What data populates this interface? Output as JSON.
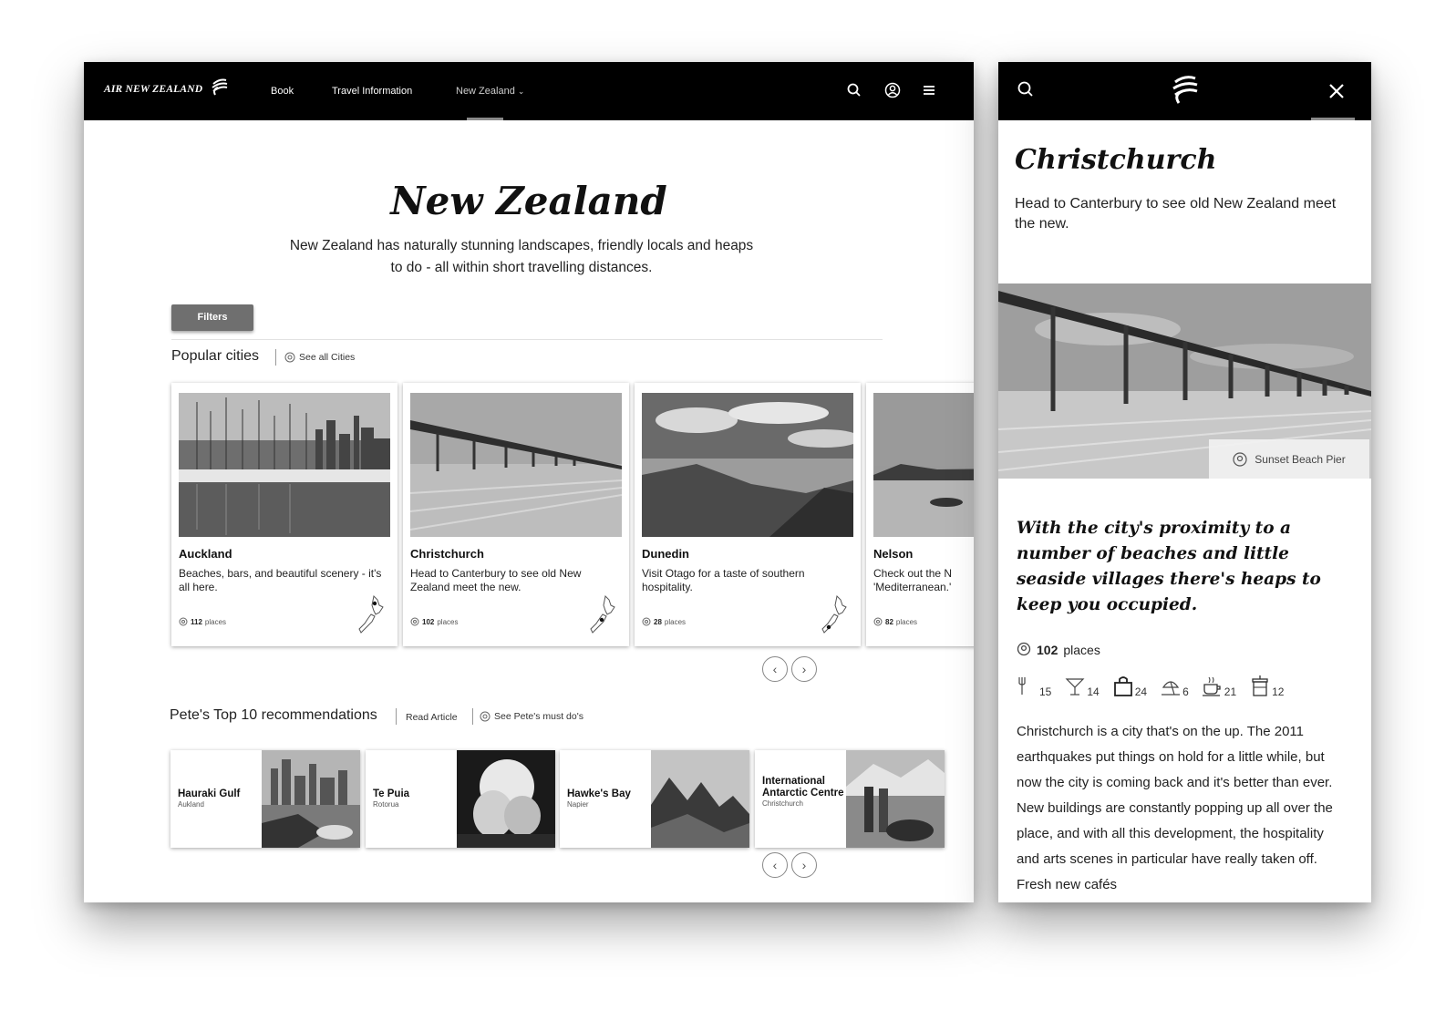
{
  "desktop": {
    "nav": {
      "brand": "AIR NEW ZEALAND",
      "links": {
        "book": "Book",
        "travel": "Travel Information",
        "nz": "New Zealand"
      }
    },
    "hero": {
      "title": "New Zealand",
      "subtitle": "New Zealand has naturally stunning landscapes, friendly locals and heaps to do - all within short travelling distances."
    },
    "filters_label": "Filters",
    "popular": {
      "title": "Popular cities",
      "see_all": "See all Cities",
      "cities": [
        {
          "name": "Auckland",
          "desc": "Beaches, bars, and beautiful scenery - it's all here.",
          "count": "112",
          "unit": "places"
        },
        {
          "name": "Christchurch",
          "desc": "Head to Canterbury to see old New Zealand meet the new.",
          "count": "102",
          "unit": "places"
        },
        {
          "name": "Dunedin",
          "desc": "Visit Otago for a taste of southern hospitality.",
          "count": "28",
          "unit": "places"
        },
        {
          "name": "Nelson",
          "desc": "Check out the N 'Mediterranean.'",
          "count": "82",
          "unit": "places"
        }
      ]
    },
    "recs": {
      "title": "Pete's Top 10 recommendations",
      "read_article": "Read Article",
      "see_must_dos": "See Pete's must do's",
      "items": [
        {
          "name": "Hauraki Gulf",
          "loc": "Aukland"
        },
        {
          "name": "Te Puia",
          "loc": "Rotorua"
        },
        {
          "name": "Hawke's Bay",
          "loc": "Napier"
        },
        {
          "name": "International Antarctic Centre",
          "loc": "Christchurch"
        }
      ]
    }
  },
  "mobile": {
    "title": "Christchurch",
    "subtitle": "Head to Canterbury to see old New Zealand meet the new.",
    "image_caption": "Sunset Beach Pier",
    "quote": "With the city's proximity to a number of beaches and little seaside villages there's heaps to keep you occupied.",
    "places_count": "102",
    "places_unit": "places",
    "amenities": [
      {
        "icon": "restaurant-icon",
        "count": "15"
      },
      {
        "icon": "bar-icon",
        "count": "14"
      },
      {
        "icon": "shopping-bag-icon",
        "count": "24"
      },
      {
        "icon": "beach-icon",
        "count": "6"
      },
      {
        "icon": "coffee-icon",
        "count": "21"
      },
      {
        "icon": "takeaway-icon",
        "count": "12"
      }
    ],
    "body": "Christchurch is a city that's on the up. The 2011 earthquakes put things on hold for a little while, but now the city is coming back and it's better than ever. New buildings are constantly popping up all over the place, and with all this development, the hospitality and arts scenes in particular have really taken off. Fresh new cafés"
  }
}
